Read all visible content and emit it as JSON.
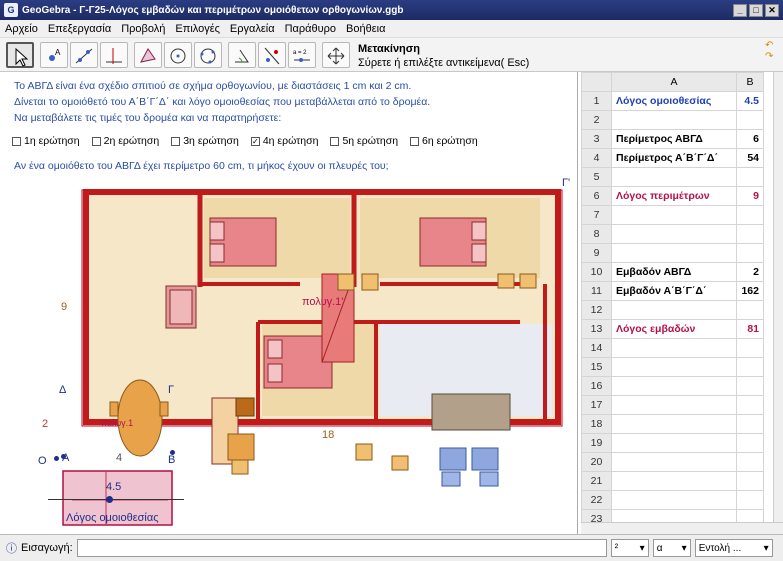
{
  "window": {
    "title": "GeoGebra - Γ-Γ25-Λόγος εμβαδών και περιμέτρων ομοιόθετων ορθογωνίων.ggb"
  },
  "menu": [
    "Αρχείο",
    "Επεξεργασία",
    "Προβολή",
    "Επιλογές",
    "Εργαλεία",
    "Παράθυρο",
    "Βοήθεια"
  ],
  "tool": {
    "name": "Μετακίνηση",
    "hint": "Σύρετε ή επιλέξτε αντικείμενα( Esc)"
  },
  "text": {
    "line1": "Το ΑΒΓΔ είναι ένα σχέδιο σπιτιού  σε σχήμα ορθογωνίου, με διαστάσεις 1 cm και 2 cm.",
    "line2": "Δίνεται το ομοιόθετό του Α΄Β΄Γ΄Δ΄ και λόγο ομοιοθεσίας που μεταβάλλεται από το δρομέα.",
    "line3": "Να μεταβάλετε τις τιμές του δρομέα και να παρατηρήσετε:",
    "question": "Αν ένα ομοιόθετο του ΑΒΓΔ έχει περίμετρο 60 cm, τι μήκος έχουν οι πλευρές του;"
  },
  "checkboxes": [
    {
      "label": "1η ερώτηση",
      "checked": false
    },
    {
      "label": "2η ερώτηση",
      "checked": false
    },
    {
      "label": "3η ερώτηση",
      "checked": false
    },
    {
      "label": "4η ερώτηση",
      "checked": true
    },
    {
      "label": "5η ερώτηση",
      "checked": false
    },
    {
      "label": "6η ερώτηση",
      "checked": false
    }
  ],
  "drawing": {
    "poly_label": "πολυγ.1'",
    "poly_small_label": "πολυγ.1",
    "dim_height": "9",
    "dim_width": "18",
    "small_height": "2",
    "small_width": "4",
    "points": {
      "A": "A",
      "B": "B",
      "G": "Γ",
      "D": "Δ",
      "O": "O",
      "Gp": "Γ'"
    },
    "slider_value": "4.5",
    "slider_label": "Λόγος ομοιοθεσίας",
    "slider_fraction": 0.45
  },
  "sheet": {
    "columns": [
      "A",
      "B"
    ],
    "rows": [
      {
        "n": "1",
        "a": "Λόγος ομοιοθεσίας",
        "b": "4.5",
        "color": "#1f3fb5"
      },
      {
        "n": "2",
        "a": "",
        "b": ""
      },
      {
        "n": "3",
        "a": "Περίμετρος ΑΒΓΔ",
        "b": "6",
        "color": "#000"
      },
      {
        "n": "4",
        "a": "Περίμετρος Α΄Β΄Γ΄Δ΄",
        "b": "54",
        "color": "#000"
      },
      {
        "n": "5",
        "a": "",
        "b": ""
      },
      {
        "n": "6",
        "a": "Λόγος περιμέτρων",
        "b": "9",
        "color": "#b5124a"
      },
      {
        "n": "7",
        "a": "",
        "b": ""
      },
      {
        "n": "8",
        "a": "",
        "b": ""
      },
      {
        "n": "9",
        "a": "",
        "b": ""
      },
      {
        "n": "10",
        "a": "Εμβαδόν ΑΒΓΔ",
        "b": "2",
        "color": "#000"
      },
      {
        "n": "11",
        "a": "Εμβαδόν Α΄Β΄Γ΄Δ΄",
        "b": "162",
        "color": "#000"
      },
      {
        "n": "12",
        "a": "",
        "b": ""
      },
      {
        "n": "13",
        "a": "Λόγος εμβαδών",
        "b": "81",
        "color": "#b5124a"
      },
      {
        "n": "14",
        "a": "",
        "b": ""
      },
      {
        "n": "15",
        "a": "",
        "b": ""
      },
      {
        "n": "16",
        "a": "",
        "b": ""
      },
      {
        "n": "17",
        "a": "",
        "b": ""
      },
      {
        "n": "18",
        "a": "",
        "b": ""
      },
      {
        "n": "19",
        "a": "",
        "b": ""
      },
      {
        "n": "20",
        "a": "",
        "b": ""
      },
      {
        "n": "21",
        "a": "",
        "b": ""
      },
      {
        "n": "22",
        "a": "",
        "b": ""
      },
      {
        "n": "23",
        "a": "",
        "b": ""
      }
    ]
  },
  "input": {
    "label": "Εισαγωγή:",
    "sel1": "²",
    "sel2": "α",
    "sel3": "Εντολή ..."
  }
}
